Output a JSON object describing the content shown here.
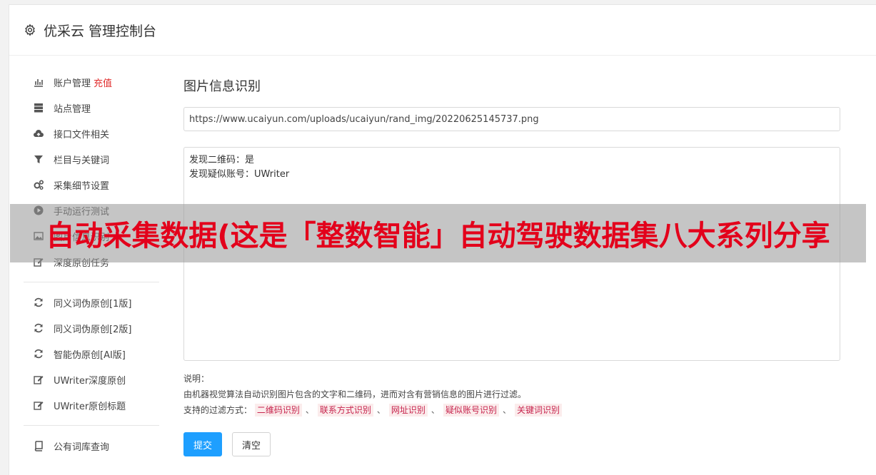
{
  "header": {
    "title": "优采云 管理控制台"
  },
  "sidebar": {
    "group1": [
      {
        "label": "账户管理",
        "badge": "充值",
        "icon": "bar-chart-icon"
      },
      {
        "label": "站点管理",
        "icon": "server-icon"
      },
      {
        "label": "接口文件相关",
        "icon": "cloud-upload-icon"
      },
      {
        "label": "栏目与关键词",
        "icon": "filter-icon"
      },
      {
        "label": "采集细节设置",
        "icon": "gears-icon"
      },
      {
        "label": "手动运行测试",
        "icon": "play-circle-icon"
      },
      {
        "label": "图片信息识别",
        "icon": "picture-icon"
      },
      {
        "label": "深度原创任务",
        "icon": "edit-icon"
      }
    ],
    "group2": [
      {
        "label": "同义词伪原创[1版]",
        "icon": "refresh-icon"
      },
      {
        "label": "同义词伪原创[2版]",
        "icon": "refresh-icon"
      },
      {
        "label": "智能伪原创[AI版]",
        "icon": "refresh-icon"
      },
      {
        "label": "UWriter深度原创",
        "icon": "edit-icon"
      },
      {
        "label": "UWriter原创标题",
        "icon": "edit-icon"
      }
    ],
    "group3": [
      {
        "label": "公有词库查询",
        "icon": "book-icon"
      }
    ]
  },
  "main": {
    "title": "图片信息识别",
    "url_value": "https://www.ucaiyun.com/uploads/ucaiyun/rand_img/20220625145737.png",
    "result_lines": [
      "发现二维码：是",
      "发现疑似账号：UWriter"
    ],
    "desc_label": "说明：",
    "desc_text": "由机器视觉算法自动识别图片包含的文字和二维码，进而对含有营销信息的图片进行过滤。",
    "filter_label": "支持的过滤方式：",
    "filter_tags": [
      "二维码识别",
      "联系方式识别",
      "网址识别",
      "疑似账号识别",
      "关键词识别"
    ],
    "filter_sep": "、",
    "submit_label": "提交",
    "clear_label": "清空"
  },
  "banner": {
    "text": "自动采集数据(这是「整数智能」自动驾驶数据集八大系列分享"
  },
  "colors": {
    "primary": "#1e9fff",
    "badge": "#e02b2b",
    "tag_text": "#c7254e",
    "banner_text": "#e3001b"
  }
}
